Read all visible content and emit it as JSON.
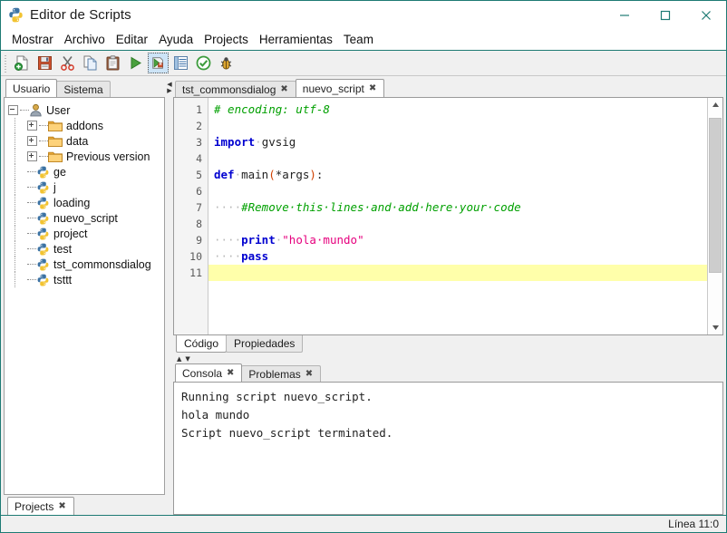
{
  "window": {
    "title": "Editor de Scripts",
    "app_icon": "python-icon",
    "minimize_label": "—",
    "maximize_label": "☐",
    "close_label": "✕",
    "border_color": "#1e7b74"
  },
  "menubar": {
    "items": [
      {
        "label": "Mostrar",
        "name": "menu-mostrar"
      },
      {
        "label": "Archivo",
        "name": "menu-archivo"
      },
      {
        "label": "Editar",
        "name": "menu-editar"
      },
      {
        "label": "Ayuda",
        "name": "menu-ayuda"
      },
      {
        "label": "Projects",
        "name": "menu-projects"
      },
      {
        "label": "Herramientas",
        "name": "menu-herramientas"
      },
      {
        "label": "Team",
        "name": "menu-team"
      }
    ]
  },
  "toolbar": {
    "buttons": [
      {
        "icon": "new-file-icon",
        "selected": false
      },
      {
        "icon": "save-icon",
        "selected": false
      },
      {
        "icon": "cut-scissors-icon",
        "selected": false
      },
      {
        "icon": "copy-icon",
        "selected": false
      },
      {
        "icon": "paste-icon",
        "selected": false
      },
      {
        "icon": "run-play-icon",
        "selected": false
      },
      {
        "icon": "run-external-icon",
        "selected": true
      },
      {
        "icon": "properties-list-icon",
        "selected": false
      },
      {
        "icon": "check-ok-icon",
        "selected": false
      },
      {
        "icon": "debug-bug-icon",
        "selected": false
      }
    ]
  },
  "left_panel": {
    "tabs": [
      {
        "label": "Usuario",
        "active": true
      },
      {
        "label": "Sistema",
        "active": false
      }
    ],
    "tree": [
      {
        "label": "User",
        "icon": "user-icon",
        "depth": 0,
        "toggle": "minus"
      },
      {
        "label": "addons",
        "icon": "folder-icon",
        "depth": 1,
        "toggle": "plus"
      },
      {
        "label": "data",
        "icon": "folder-icon",
        "depth": 1,
        "toggle": "plus"
      },
      {
        "label": "Previous version",
        "icon": "folder-icon",
        "depth": 1,
        "toggle": "plus"
      },
      {
        "label": "ge",
        "icon": "python-file-icon",
        "depth": 1,
        "toggle": "none"
      },
      {
        "label": "j",
        "icon": "python-file-icon",
        "depth": 1,
        "toggle": "none"
      },
      {
        "label": "loading",
        "icon": "python-file-icon",
        "depth": 1,
        "toggle": "none"
      },
      {
        "label": "nuevo_script",
        "icon": "python-file-icon",
        "depth": 1,
        "toggle": "none"
      },
      {
        "label": "project",
        "icon": "python-file-icon",
        "depth": 1,
        "toggle": "none"
      },
      {
        "label": "test",
        "icon": "python-file-icon",
        "depth": 1,
        "toggle": "none"
      },
      {
        "label": "tst_commonsdialog",
        "icon": "python-file-icon",
        "depth": 1,
        "toggle": "none"
      },
      {
        "label": "tsttt",
        "icon": "python-file-icon",
        "depth": 1,
        "toggle": "none"
      }
    ]
  },
  "editor": {
    "tabs": [
      {
        "label": "tst_commonsdialog",
        "active": false,
        "close": "✖"
      },
      {
        "label": "nuevo_script",
        "active": true,
        "close": "✖"
      }
    ],
    "line_numbers": [
      "1",
      "2",
      "3",
      "4",
      "5",
      "6",
      "7",
      "8",
      "9",
      "10",
      "11"
    ],
    "current_line": 11,
    "lines": [
      {
        "n": 1,
        "tokens": [
          {
            "t": "# encoding: utf-8",
            "c": "cm"
          }
        ]
      },
      {
        "n": 2,
        "tokens": []
      },
      {
        "n": 3,
        "tokens": [
          {
            "t": "import",
            "c": "k"
          },
          {
            "t": "·",
            "c": "ws"
          },
          {
            "t": "gvsig",
            "c": "pl"
          }
        ]
      },
      {
        "n": 4,
        "tokens": []
      },
      {
        "n": 5,
        "tokens": [
          {
            "t": "def",
            "c": "k"
          },
          {
            "t": "·",
            "c": "ws"
          },
          {
            "t": "main",
            "c": "pl"
          },
          {
            "t": "(",
            "c": "pn"
          },
          {
            "t": "*args",
            "c": "pl"
          },
          {
            "t": ")",
            "c": "pn"
          },
          {
            "t": ":",
            "c": "pl"
          }
        ]
      },
      {
        "n": 6,
        "tokens": []
      },
      {
        "n": 7,
        "tokens": [
          {
            "t": "····",
            "c": "ws"
          },
          {
            "t": "#Remove·this·lines·and·add·here·your·code",
            "c": "cm"
          }
        ]
      },
      {
        "n": 8,
        "tokens": []
      },
      {
        "n": 9,
        "tokens": [
          {
            "t": "····",
            "c": "ws"
          },
          {
            "t": "print",
            "c": "k"
          },
          {
            "t": "·",
            "c": "ws"
          },
          {
            "t": "\"hola·mundo\"",
            "c": "st"
          }
        ]
      },
      {
        "n": 10,
        "tokens": [
          {
            "t": "····",
            "c": "ws"
          },
          {
            "t": "pass",
            "c": "k"
          }
        ]
      },
      {
        "n": 11,
        "tokens": []
      }
    ],
    "plain_text": "# encoding: utf-8\n\nimport gvsig\n\ndef main(*args):\n\n    #Remove this lines and add here your code\n\n    print \"hola mundo\"\n    pass\n",
    "bottom_tabs": [
      {
        "label": "Código",
        "active": true
      },
      {
        "label": "Propiedades",
        "active": false
      }
    ],
    "scrollbar": {
      "up": "▲",
      "down": "▼",
      "thumb_position_pct": 3,
      "thumb_size_pct": 73
    },
    "current_line_highlight_color": "#ffffaa"
  },
  "console": {
    "tabs": [
      {
        "label": "Consola",
        "active": true,
        "close": "✖"
      },
      {
        "label": "Problemas",
        "active": false,
        "close": "✖"
      }
    ],
    "output": [
      "Running script nuevo_script.",
      "hola mundo",
      "Script nuevo_script terminated."
    ]
  },
  "bottom": {
    "tabs": [
      {
        "label": "Projects",
        "active": true,
        "close": "✖"
      }
    ]
  },
  "statusbar": {
    "position": "Línea 11:0"
  },
  "splitters": {
    "vertical_arrows": [
      "◀",
      "▶"
    ],
    "horizontal_arrows": [
      "▲",
      "▼"
    ]
  },
  "colors": {
    "accent": "#1e7b74",
    "panel_bg": "#f0f0f0",
    "editor_bg": "#ffffff",
    "keyword": "#0000d0",
    "comment": "#00a000",
    "string": "#e6007e",
    "punct": "#d04000",
    "whitespace_dot": "#b9b9b9",
    "toolbar_selected": "#cde4f7"
  }
}
